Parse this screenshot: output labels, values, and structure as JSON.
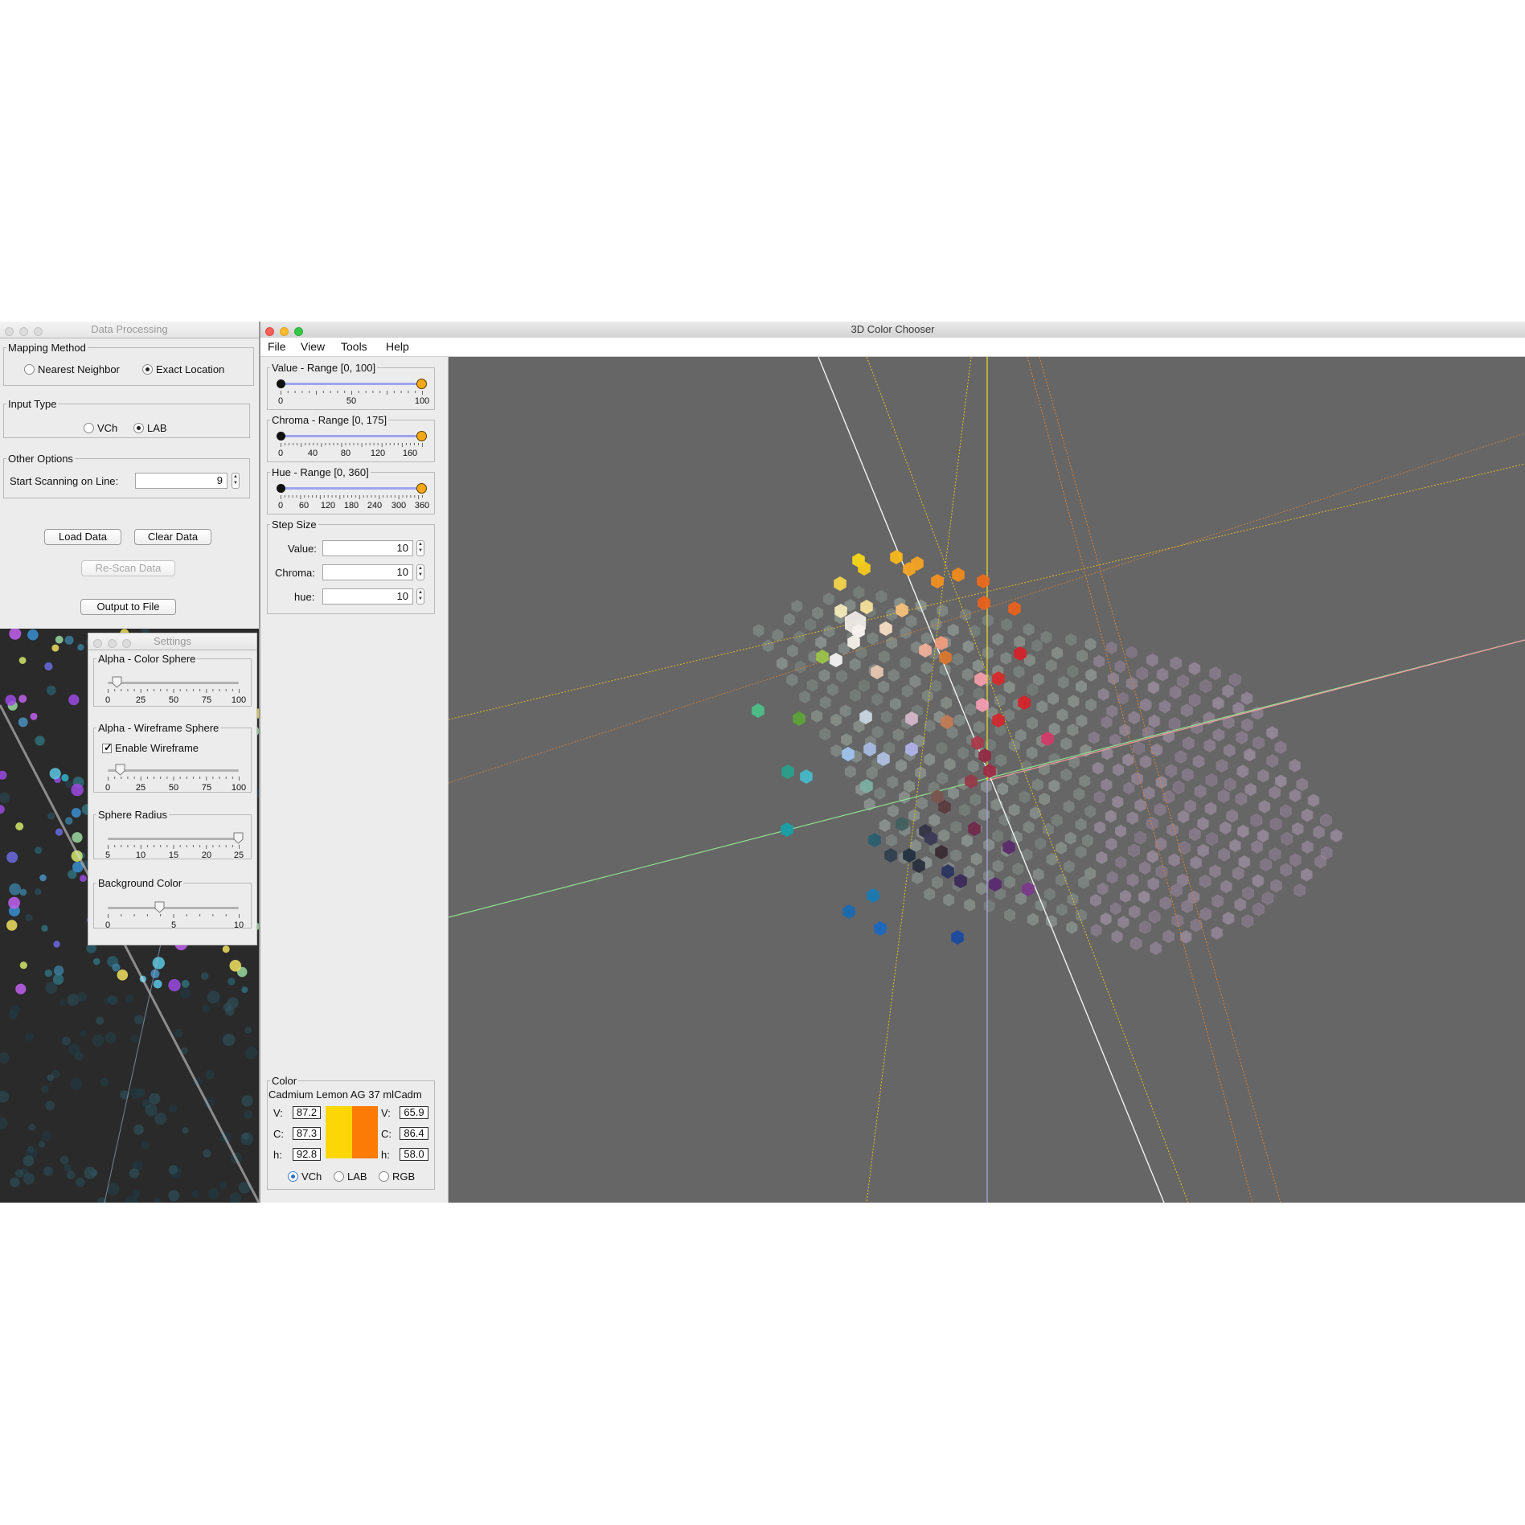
{
  "data_processing": {
    "title": "Data Processing",
    "mapping_method": {
      "legend": "Mapping Method",
      "options": [
        {
          "label": "Nearest Neighbor",
          "selected": false
        },
        {
          "label": "Exact Location",
          "selected": true
        }
      ]
    },
    "input_type": {
      "legend": "Input Type",
      "options": [
        {
          "label": "VCh",
          "selected": false
        },
        {
          "label": "LAB",
          "selected": true
        }
      ]
    },
    "other_options": {
      "legend": "Other Options",
      "start_line_label": "Start Scanning on Line:",
      "start_line_value": "9"
    },
    "buttons": {
      "load": "Load Data",
      "clear": "Clear Data",
      "rescan": "Re-Scan Data",
      "output": "Output to File"
    }
  },
  "settings": {
    "title": "Settings",
    "alpha_color": {
      "legend": "Alpha - Color Sphere",
      "ticks": [
        "0",
        "25",
        "50",
        "75",
        "100"
      ],
      "value": 8
    },
    "alpha_wire": {
      "legend": "Alpha - Wireframe Sphere",
      "checkbox_label": "Enable Wireframe",
      "checked": true,
      "ticks": [
        "0",
        "25",
        "50",
        "75",
        "100"
      ],
      "value": 10
    },
    "radius": {
      "legend": "Sphere Radius",
      "ticks": [
        "5",
        "10",
        "15",
        "20",
        "25"
      ],
      "value": 25
    },
    "background": {
      "legend": "Background Color",
      "ticks": [
        "0",
        "5",
        "10"
      ],
      "value": 4
    }
  },
  "chooser": {
    "title": "3D Color Chooser",
    "menu": [
      "File",
      "View",
      "Tools",
      "Help"
    ],
    "value_range": {
      "legend": "Value - Range [0, 100]",
      "ticks": [
        "0",
        "50",
        "100"
      ],
      "low": 0,
      "high": 100
    },
    "chroma_range": {
      "legend": "Chroma - Range [0, 175]",
      "ticks": [
        "0",
        "40",
        "80",
        "120",
        "160"
      ],
      "low": 0,
      "high": 175
    },
    "hue_range": {
      "legend": "Hue - Range [0, 360]",
      "ticks": [
        "0",
        "60",
        "120",
        "180",
        "240",
        "300",
        "360"
      ],
      "low": 0,
      "high": 360
    },
    "step_size": {
      "legend": "Step Size",
      "value_label": "Value:",
      "value": "10",
      "chroma_label": "Chroma:",
      "chroma": "10",
      "hue_label": "hue:",
      "hue": "10"
    },
    "color": {
      "legend": "Color",
      "name": "Cadmium Lemon AG 37 mlCadm",
      "left": {
        "v_label": "V:",
        "v": "87.2",
        "c_label": "C:",
        "c": "87.3",
        "h_label": "h:",
        "h": "92.8",
        "swatch": "#fcd606"
      },
      "right": {
        "v_label": "V:",
        "v": "65.9",
        "c_label": "C:",
        "c": "86.4",
        "h_label": "h:",
        "h": "58.0",
        "swatch": "#fc7a06"
      },
      "modes": [
        {
          "label": "VCh",
          "selected": true
        },
        {
          "label": "LAB",
          "selected": false
        },
        {
          "label": "RGB",
          "selected": false
        }
      ]
    },
    "viewport_bg": "#666666"
  }
}
